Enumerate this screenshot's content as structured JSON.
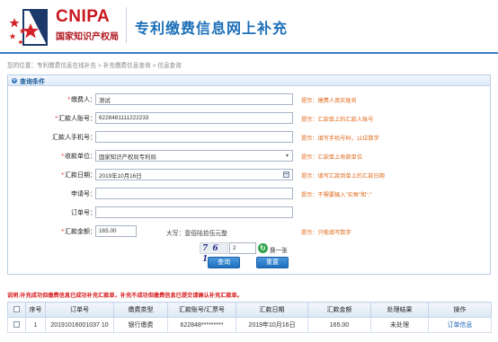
{
  "header": {
    "logo_en": "CNIPA",
    "logo_cn": "国家知识产权局",
    "site_title": "专利缴费信息网上补充"
  },
  "breadcrumb": {
    "prefix": "您的位置：",
    "items": [
      "专利缴费信息在线补充",
      "补充缴费信息查询",
      "信息查询"
    ],
    "separator": ">"
  },
  "query_panel": {
    "title": "查询条件",
    "fields": {
      "payer": {
        "label": "缴费人：",
        "value": "测试",
        "hint": "提示：缴费人真实姓名",
        "required": true
      },
      "account": {
        "label": "汇款人账号：",
        "value": "6228481111222233",
        "hint": "提示：汇款单上的汇款人账号",
        "required": true
      },
      "phone": {
        "label": "汇款人手机号：",
        "value": "",
        "hint": "提示：填写手机号码，11位数字",
        "required": false
      },
      "receiver": {
        "label": "收款单位：",
        "value": "国家知识产权局专利局",
        "hint": "提示：汇款单上收款单位",
        "required": true
      },
      "date": {
        "label": "汇款日期：",
        "value": "2019年10月16日",
        "hint": "提示：填写汇款到单上的汇款日期",
        "required": true
      },
      "application_no": {
        "label": "申请号：",
        "value": "",
        "hint": "提示：不需要输入\"实框\"和\".\"",
        "required": false
      },
      "order_no": {
        "label": "订单号：",
        "value": "",
        "hint": "",
        "required": false
      },
      "amount": {
        "label": "汇款金额：",
        "value": "165.00",
        "words_label": "大写：",
        "words": "壹佰陆拾伍元整",
        "hint": "提示：只能填写数字",
        "required": true
      }
    },
    "captcha": {
      "code": "7 6 1",
      "input": "2",
      "refresh_label": "换一张"
    },
    "buttons": {
      "query": "查询",
      "reset": "重置"
    }
  },
  "notice": "说明:补充成功但缴费信息已成功补充汇款单，补充不成功但缴费信息已提交请确认补充汇款单。",
  "table": {
    "headers": [
      "",
      "序号",
      "订单号",
      "缴费类型",
      "汇款账号/汇票号",
      "汇款日期",
      "汇款金额",
      "处理结果",
      "操作"
    ],
    "rows": [
      {
        "index": "1",
        "order_no": "20191016001037 10",
        "type": "银行缴费",
        "account": "622848*********",
        "date": "2019年10月16日",
        "amount": "165.00",
        "status": "未处理",
        "action": "订单信息"
      }
    ]
  },
  "colors": {
    "brand_red": "#c8161d",
    "title_blue": "#1c6fb8",
    "hint_orange": "#e06a1c",
    "notice_red": "#d7191c",
    "button_blue": "#1f6fbc"
  }
}
